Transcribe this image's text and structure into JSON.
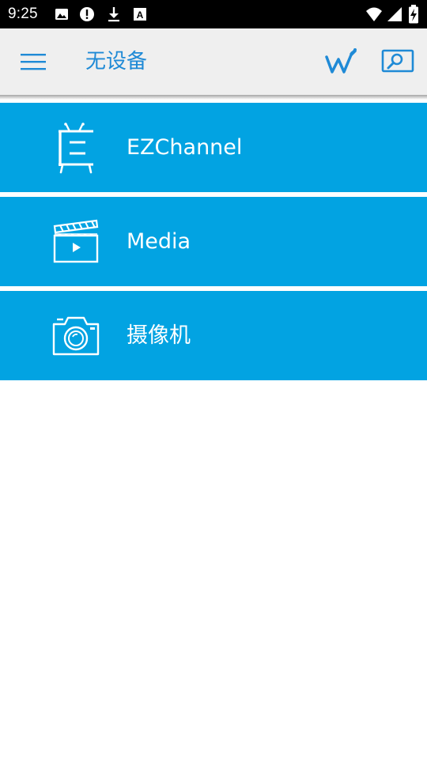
{
  "status_bar": {
    "time": "9:25",
    "left_icons": [
      "image-icon",
      "alert-icon",
      "download-icon",
      "a-icon"
    ],
    "right_icons": [
      "wifi-signal-icon",
      "cell-signal-icon",
      "battery-charging-icon"
    ]
  },
  "toolbar": {
    "title": "无设备",
    "menu_icon": "hamburger-menu-icon",
    "wifi_icon": "wifi-setup-icon",
    "cast_icon": "screen-cast-icon"
  },
  "menu": {
    "items": [
      {
        "label": "EZChannel",
        "icon": "tv-icon"
      },
      {
        "label": "Media",
        "icon": "clapperboard-icon"
      },
      {
        "label": "摄像机",
        "icon": "camera-icon"
      }
    ]
  },
  "colors": {
    "accent": "#1f8ad6",
    "item_bg": "#02a3e2",
    "toolbar_bg": "#efefef",
    "status_bg": "#000000"
  }
}
